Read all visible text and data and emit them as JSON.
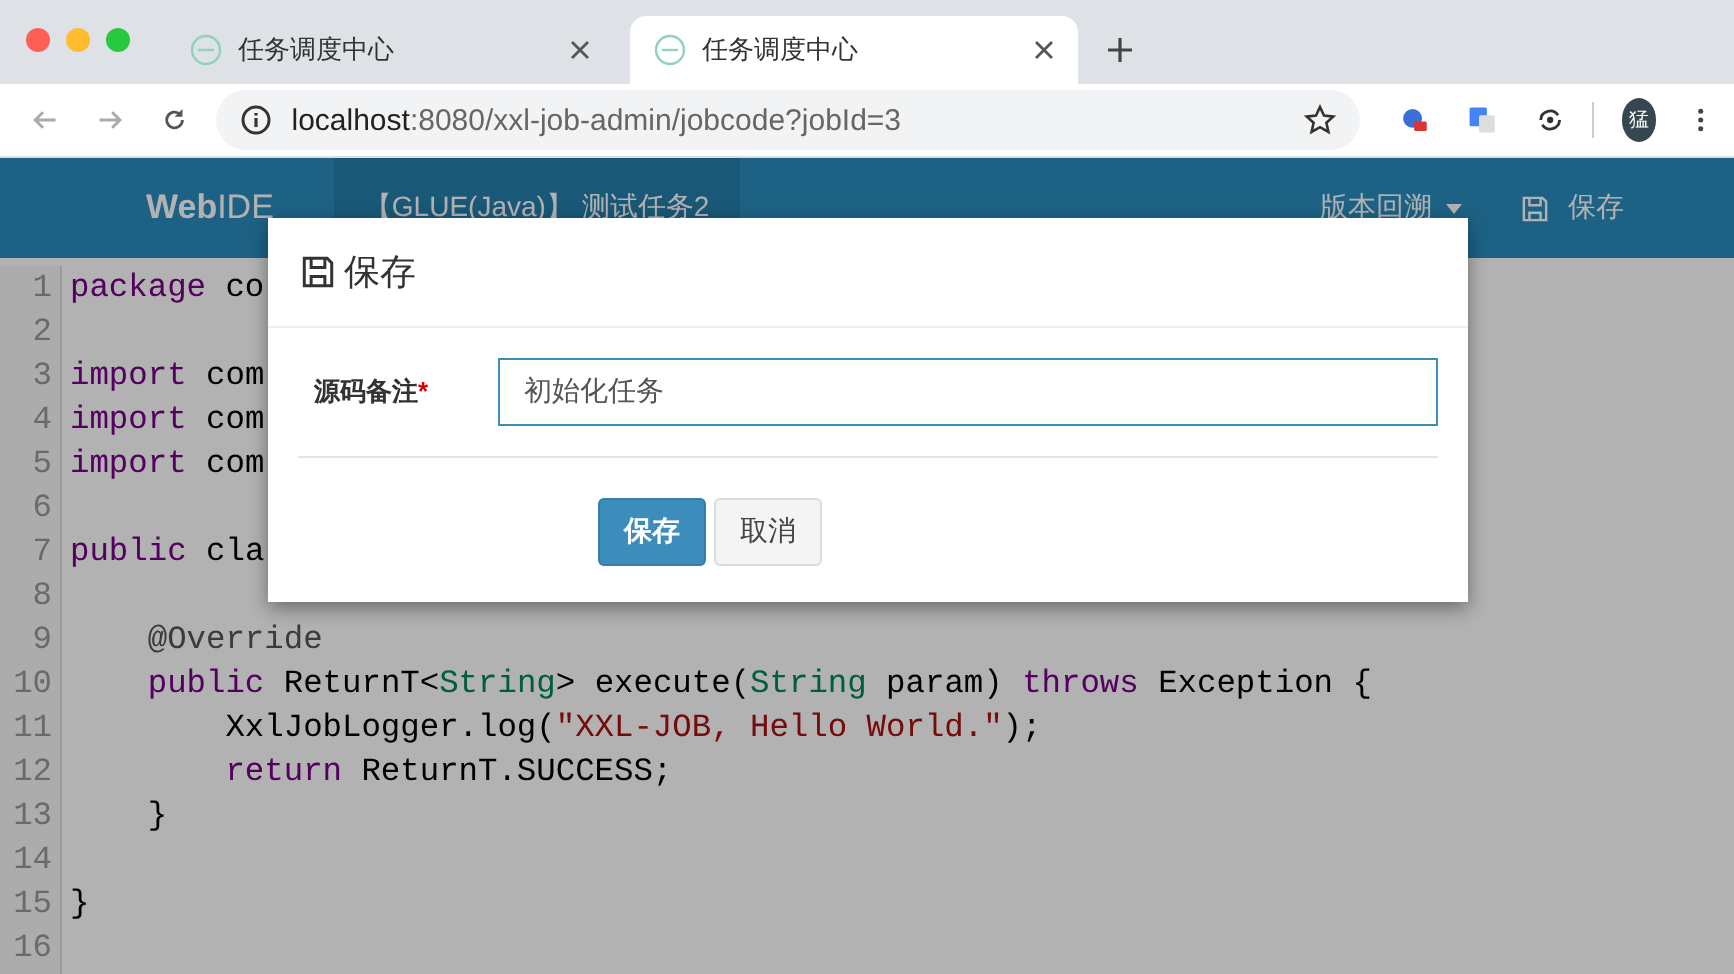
{
  "browser": {
    "tabs": [
      {
        "title": "任务调度中心",
        "selected": false
      },
      {
        "title": "任务调度中心",
        "selected": true
      }
    ],
    "address": {
      "host": "localhost",
      "path": ":8080/xxl-job-admin/jobcode?jobId=3"
    },
    "avatar": "猛"
  },
  "navbar": {
    "brand": "**Web**IDE",
    "items": [
      {
        "label": "【GLUE(Java)】 测试任务2",
        "selected": true
      }
    ],
    "history_menu": "版本回溯",
    "save": "保存"
  },
  "editor": {
    "lines": [
      {
        "number": "1",
        "tokens": [
          {
            "kind": "keyword",
            "text": "package"
          },
          {
            "kind": "plain",
            "text": " co"
          }
        ]
      },
      {
        "number": "2"
      },
      {
        "number": "3",
        "tokens": [
          {
            "kind": "keyword",
            "text": "import"
          },
          {
            "kind": "plain",
            "text": " com"
          }
        ]
      },
      {
        "number": "4",
        "tokens": [
          {
            "kind": "keyword",
            "text": "import"
          },
          {
            "kind": "plain",
            "text": " com"
          }
        ]
      },
      {
        "number": "5",
        "tokens": [
          {
            "kind": "keyword",
            "text": "import"
          },
          {
            "kind": "plain",
            "text": " com"
          }
        ]
      },
      {
        "number": "6"
      },
      {
        "number": "7",
        "tokens": [
          {
            "kind": "keyword",
            "text": "public"
          },
          {
            "kind": "plain",
            "text": " cla"
          }
        ]
      },
      {
        "number": "8"
      },
      {
        "number": "9",
        "tokens": [
          {
            "kind": "meta",
            "text": "    @Override"
          }
        ]
      },
      {
        "number": "10",
        "tokens": [
          {
            "kind": "keyword",
            "text": "    public"
          },
          {
            "kind": "plain",
            "text": " ReturnT<"
          },
          {
            "kind": "type",
            "text": "String"
          },
          {
            "kind": "plain",
            "text": "> execute("
          },
          {
            "kind": "type",
            "text": "String"
          },
          {
            "kind": "plain",
            "text": " param) "
          },
          {
            "kind": "keyword",
            "text": "throws"
          },
          {
            "kind": "plain",
            "text": " Exception {"
          }
        ]
      },
      {
        "number": "11",
        "tokens": [
          {
            "kind": "plain",
            "text": "        XxlJobLogger.log("
          },
          {
            "kind": "string",
            "text": "\"XXL-JOB, Hello World.\""
          },
          {
            "kind": "plain",
            "text": ");"
          }
        ]
      },
      {
        "number": "12",
        "tokens": [
          {
            "kind": "keyword",
            "text": "        return"
          },
          {
            "kind": "plain",
            "text": " ReturnT.SUCCESS;"
          }
        ]
      },
      {
        "number": "13",
        "tokens": [
          {
            "kind": "plain",
            "text": "    }"
          }
        ]
      },
      {
        "number": "14"
      },
      {
        "number": "15",
        "tokens": [
          {
            "kind": "plain",
            "text": "}"
          }
        ]
      },
      {
        "number": "16"
      }
    ]
  },
  "modal": {
    "title": "保存",
    "field": {
      "label": "源码备注",
      "required_mark": "*",
      "value": "初始化任务"
    },
    "buttons": [
      {
        "label": "保存",
        "kind": "primary"
      },
      {
        "label": "取消",
        "kind": "default"
      }
    ]
  }
}
